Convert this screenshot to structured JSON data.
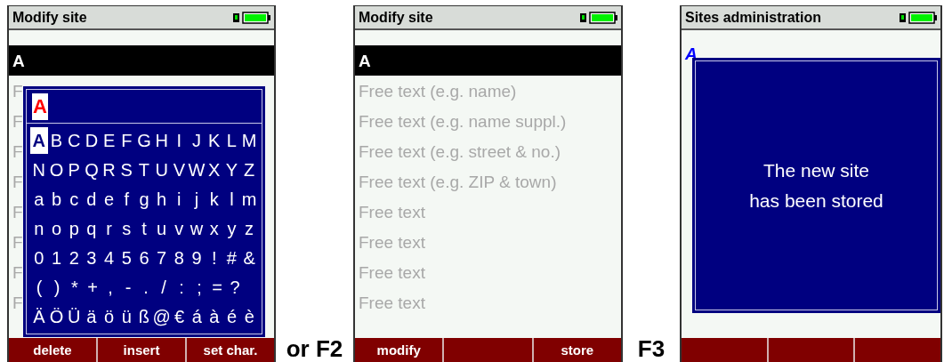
{
  "panels": [
    {
      "kind": "keyboard",
      "title": "Modify site",
      "fields": [
        {
          "text": "A",
          "selected": true
        },
        {
          "text": "F",
          "selected": false
        },
        {
          "text": "F",
          "selected": false
        },
        {
          "text": "F",
          "selected": false
        },
        {
          "text": "F",
          "selected": false
        },
        {
          "text": "F",
          "selected": false
        },
        {
          "text": "F",
          "selected": false
        },
        {
          "text": "F",
          "selected": false
        },
        {
          "text": "F",
          "selected": false
        }
      ],
      "keyboard": {
        "input": "A",
        "rows": [
          [
            {
              "char": "A",
              "selected": true
            },
            {
              "char": "B",
              "selected": false
            },
            {
              "char": "C",
              "selected": false
            },
            {
              "char": "D",
              "selected": false
            },
            {
              "char": "E",
              "selected": false
            },
            {
              "char": "F",
              "selected": false
            },
            {
              "char": "G",
              "selected": false
            },
            {
              "char": "H",
              "selected": false
            },
            {
              "char": "I",
              "selected": false
            },
            {
              "char": "J",
              "selected": false
            },
            {
              "char": "K",
              "selected": false
            },
            {
              "char": "L",
              "selected": false
            },
            {
              "char": "M",
              "selected": false
            }
          ],
          [
            {
              "char": "N",
              "selected": false
            },
            {
              "char": "O",
              "selected": false
            },
            {
              "char": "P",
              "selected": false
            },
            {
              "char": "Q",
              "selected": false
            },
            {
              "char": "R",
              "selected": false
            },
            {
              "char": "S",
              "selected": false
            },
            {
              "char": "T",
              "selected": false
            },
            {
              "char": "U",
              "selected": false
            },
            {
              "char": "V",
              "selected": false
            },
            {
              "char": "W",
              "selected": false
            },
            {
              "char": "X",
              "selected": false
            },
            {
              "char": "Y",
              "selected": false
            },
            {
              "char": "Z",
              "selected": false
            }
          ],
          [
            {
              "char": "a",
              "selected": false
            },
            {
              "char": "b",
              "selected": false
            },
            {
              "char": "c",
              "selected": false
            },
            {
              "char": "d",
              "selected": false
            },
            {
              "char": "e",
              "selected": false
            },
            {
              "char": "f",
              "selected": false
            },
            {
              "char": "g",
              "selected": false
            },
            {
              "char": "h",
              "selected": false
            },
            {
              "char": "i",
              "selected": false
            },
            {
              "char": "j",
              "selected": false
            },
            {
              "char": "k",
              "selected": false
            },
            {
              "char": "l",
              "selected": false
            },
            {
              "char": "m",
              "selected": false
            }
          ],
          [
            {
              "char": "n",
              "selected": false
            },
            {
              "char": "o",
              "selected": false
            },
            {
              "char": "p",
              "selected": false
            },
            {
              "char": "q",
              "selected": false
            },
            {
              "char": "r",
              "selected": false
            },
            {
              "char": "s",
              "selected": false
            },
            {
              "char": "t",
              "selected": false
            },
            {
              "char": "u",
              "selected": false
            },
            {
              "char": "v",
              "selected": false
            },
            {
              "char": "w",
              "selected": false
            },
            {
              "char": "x",
              "selected": false
            },
            {
              "char": "y",
              "selected": false
            },
            {
              "char": "z",
              "selected": false
            }
          ],
          [
            {
              "char": "0",
              "selected": false
            },
            {
              "char": "1",
              "selected": false
            },
            {
              "char": "2",
              "selected": false
            },
            {
              "char": "3",
              "selected": false
            },
            {
              "char": "4",
              "selected": false
            },
            {
              "char": "5",
              "selected": false
            },
            {
              "char": "6",
              "selected": false
            },
            {
              "char": "7",
              "selected": false
            },
            {
              "char": "8",
              "selected": false
            },
            {
              "char": "9",
              "selected": false
            },
            {
              "char": "!",
              "selected": false
            },
            {
              "char": "#",
              "selected": false
            },
            {
              "char": "&",
              "selected": false
            }
          ],
          [
            {
              "char": "(",
              "selected": false
            },
            {
              "char": ")",
              "selected": false
            },
            {
              "char": "*",
              "selected": false
            },
            {
              "char": "+",
              "selected": false
            },
            {
              "char": ",",
              "selected": false
            },
            {
              "char": "-",
              "selected": false
            },
            {
              "char": ".",
              "selected": false
            },
            {
              "char": "/",
              "selected": false
            },
            {
              "char": ":",
              "selected": false
            },
            {
              "char": ";",
              "selected": false
            },
            {
              "char": "=",
              "selected": false
            },
            {
              "char": "?",
              "selected": false
            }
          ],
          [
            {
              "char": "Ä",
              "selected": false
            },
            {
              "char": "Ö",
              "selected": false
            },
            {
              "char": "Ü",
              "selected": false
            },
            {
              "char": "ä",
              "selected": false
            },
            {
              "char": "ö",
              "selected": false
            },
            {
              "char": "ü",
              "selected": false
            },
            {
              "char": "ß",
              "selected": false
            },
            {
              "char": "@",
              "selected": false
            },
            {
              "char": "€",
              "selected": false
            },
            {
              "char": "á",
              "selected": false
            },
            {
              "char": "à",
              "selected": false
            },
            {
              "char": "é",
              "selected": false
            },
            {
              "char": "è",
              "selected": false
            }
          ]
        ]
      },
      "softkeys": [
        {
          "kind": "labeled",
          "label": "delete"
        },
        {
          "kind": "labeled",
          "label": "insert"
        },
        {
          "kind": "labeled",
          "label": "set char."
        }
      ]
    },
    {
      "kind": "caption",
      "text": "or F2"
    },
    {
      "kind": "list",
      "title": "Modify site",
      "fields": [
        {
          "text": "A",
          "selected": true
        },
        {
          "text": "Free text (e.g. name)",
          "selected": false
        },
        {
          "text": "Free text (e.g. name suppl.)",
          "selected": false
        },
        {
          "text": "Free text (e.g. street & no.)",
          "selected": false
        },
        {
          "text": "Free text (e.g. ZIP & town)",
          "selected": false
        },
        {
          "text": "Free text",
          "selected": false
        },
        {
          "text": "Free text",
          "selected": false
        },
        {
          "text": "Free text",
          "selected": false
        },
        {
          "text": "Free text",
          "selected": false
        }
      ],
      "softkeys": [
        {
          "kind": "labeled",
          "label": "modify"
        },
        {
          "kind": "blank"
        },
        {
          "kind": "labeled",
          "label": "store"
        }
      ]
    },
    {
      "kind": "caption",
      "text": "F3"
    },
    {
      "kind": "message",
      "title": "Sites administration",
      "entries": [
        {
          "text": "A"
        }
      ],
      "message": [
        "The new site",
        "has been stored"
      ],
      "softkeys": [
        {
          "kind": "blank"
        },
        {
          "kind": "blank"
        },
        {
          "kind": "blank"
        }
      ]
    }
  ]
}
